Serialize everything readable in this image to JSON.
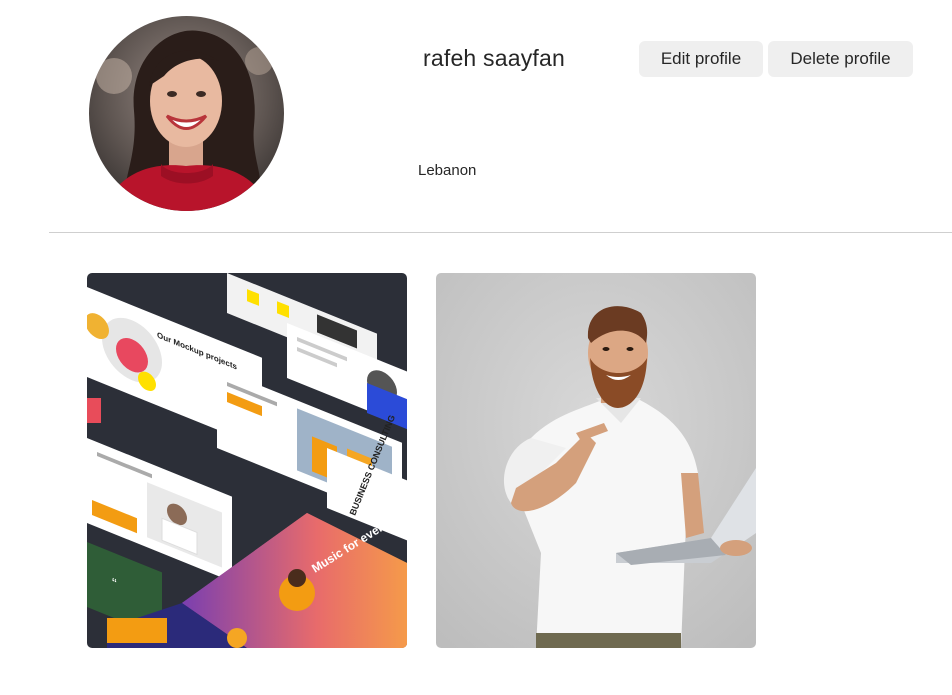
{
  "profile": {
    "username": "rafeh saayfan",
    "location": "Lebanon",
    "avatar_alt": "profile-photo-woman-smiling"
  },
  "actions": {
    "edit_label": "Edit profile",
    "delete_label": "Delete profile"
  },
  "posts": [
    {
      "kind": "presentation-mockup-collage",
      "texts": {
        "mockup_heading": "Our Mockup projects",
        "consulting_heading": "BUSINESS CONSULTING",
        "music_heading": "Music for everyone"
      }
    },
    {
      "kind": "photo-man-pointing-at-laptop"
    }
  ],
  "colors": {
    "button_bg": "#efefef",
    "divider": "#cfcfcf",
    "text": "#262626"
  }
}
